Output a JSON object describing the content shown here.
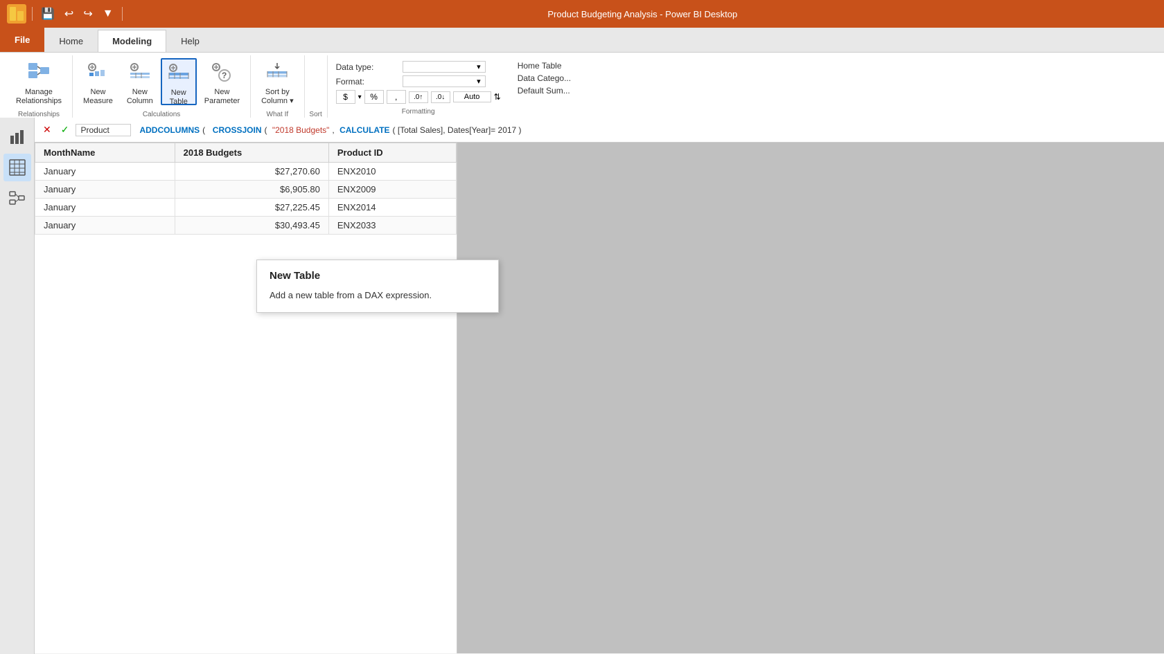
{
  "titleBar": {
    "logo": "P",
    "title": "Product Budgeting Analysis - Power BI Desktop",
    "controls": [
      "↩",
      "↪",
      "▼"
    ]
  },
  "ribbonTabs": [
    {
      "id": "file",
      "label": "File",
      "class": "file-tab"
    },
    {
      "id": "home",
      "label": "Home",
      "class": ""
    },
    {
      "id": "modeling",
      "label": "Modeling",
      "class": "active"
    },
    {
      "id": "help",
      "label": "Help",
      "class": ""
    }
  ],
  "ribbonGroups": [
    {
      "id": "relationships",
      "label": "Relationships",
      "buttons": [
        {
          "id": "manage-relationships",
          "label": "Manage\nRelationships",
          "icon": "🔗"
        }
      ]
    },
    {
      "id": "calculations",
      "label": "Calculations",
      "buttons": [
        {
          "id": "new-measure",
          "label": "New\nMeasure",
          "icon": "⚙📊"
        },
        {
          "id": "new-column",
          "label": "New\nColumn",
          "icon": "⚙📋"
        },
        {
          "id": "new-table",
          "label": "New\nTable",
          "icon": "⚙🗃",
          "selected": true
        },
        {
          "id": "new-parameter",
          "label": "New\nParameter",
          "icon": "⚙❓"
        }
      ]
    },
    {
      "id": "whatif",
      "label": "What If",
      "buttons": [
        {
          "id": "sort-by-column",
          "label": "Sort by\nColumn",
          "icon": "⇅🗃",
          "dropdown": true
        }
      ]
    },
    {
      "id": "sort",
      "label": "Sort"
    },
    {
      "id": "formatting",
      "label": "Formatting",
      "dataType": "Data type:",
      "format": "Format:",
      "currency": "$",
      "percent": "%",
      "comma": ",",
      "decimal": ".0",
      "auto": "Auto",
      "homeTable": "Home Table",
      "dataCategory": "Data Catego...",
      "defaultSum": "Default Sum..."
    }
  ],
  "formulaBar": {
    "cancelLabel": "✕",
    "confirmLabel": "✓",
    "fieldName": "Product",
    "formula": [
      {
        "type": "keyword",
        "text": "ADDCOLUMNS"
      },
      {
        "type": "text",
        "text": "("
      },
      {
        "type": "keyword",
        "text": "CROSSJOIN"
      },
      {
        "type": "text",
        "text": "( "
      },
      {
        "type": "string",
        "text": "\"2018 Budgets\""
      },
      {
        "type": "text",
        "text": ", "
      },
      {
        "type": "keyword",
        "text": "CALCULATE"
      },
      {
        "type": "text",
        "text": "( ["
      },
      {
        "type": "text",
        "text": "Total Sales"
      },
      {
        "type": "text",
        "text": "], Dates[Year]= 2017 )"
      }
    ]
  },
  "tooltip": {
    "title": "New Table",
    "description": "Add a new table from a DAX expression."
  },
  "sidebarIcons": [
    {
      "id": "bar-chart",
      "icon": "📊",
      "active": false
    },
    {
      "id": "table-view",
      "icon": "⊞",
      "active": true
    },
    {
      "id": "model-view",
      "icon": "⋮⋮",
      "active": false
    }
  ],
  "tableHeaders": [
    "MonthName",
    "2018 Budgets",
    "Product ID"
  ],
  "tableRows": [
    {
      "month": "January",
      "budget": "$27,270.60",
      "productId": "ENX2010"
    },
    {
      "month": "January",
      "budget": "$6,905.80",
      "productId": "ENX2009"
    },
    {
      "month": "January",
      "budget": "$27,225.45",
      "productId": "ENX2014"
    },
    {
      "month": "January",
      "budget": "$30,493.45",
      "productId": "ENX2033"
    }
  ]
}
